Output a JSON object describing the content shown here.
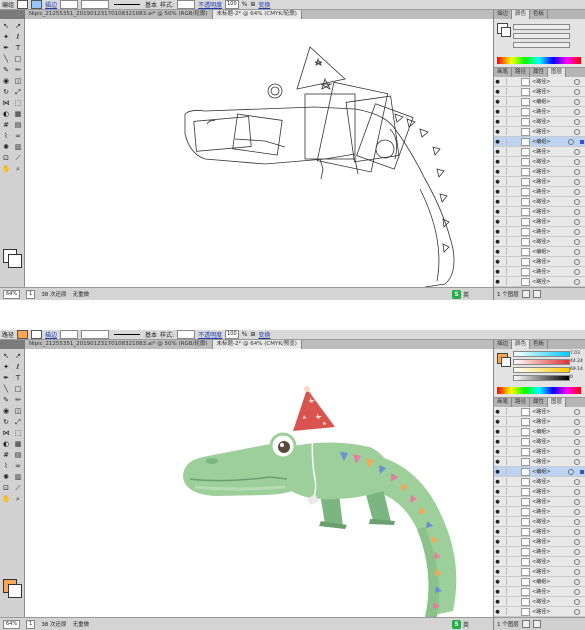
{
  "shot1": {
    "control_bar": {
      "tool_label": "编组",
      "stroke_link": "描边",
      "stroke_weight": "基本",
      "style_label": "样式:",
      "opacity_link": "不透明度",
      "opacity_value": "100",
      "opacity_unit": "%",
      "transform_link": "变换",
      "fill_color": "#ffffff",
      "stroke_color": "#9ac5ff"
    },
    "doc_tabs": [
      {
        "label": "Nipic_21255351_20190123170108321083.ai* @ 50% (RGB/轮廓)"
      },
      {
        "label": "未标题-2* @ 64% (CMYK/轮廓)"
      }
    ],
    "status": {
      "zoom": "64%",
      "page": "1",
      "undo": "38 次还原",
      "undo2": "无重做"
    },
    "panel_tabs": [
      "描边",
      "颜色",
      "色板"
    ],
    "layer_tabs": [
      "画笔",
      "路径",
      "属性",
      "图层"
    ],
    "layers": [
      "<路径>",
      "<路径>",
      "<编组>",
      "<路径>",
      "<路径>",
      "<路径>",
      "<编组>",
      "<路径>",
      "<路径>",
      "<路径>",
      "<路径>",
      "<路径>",
      "<路径>",
      "<路径>",
      "<路径>",
      "<路径>",
      "<路径>",
      "<编组>",
      "<路径>",
      "<路径>",
      "<路径>",
      "<路径>",
      "<路径>"
    ],
    "layer_count": "1 个图层",
    "ime": "英"
  },
  "shot2": {
    "control_bar": {
      "tool_label": "路径",
      "stroke_link": "描边",
      "stroke_weight": "基本",
      "style_label": "样式:",
      "opacity_link": "不透明度",
      "opacity_value": "100",
      "opacity_unit": "%",
      "transform_link": "变换",
      "fill_color": "#f5a755",
      "stroke_color": "#ffffff"
    },
    "doc_tabs": [
      {
        "label": "Nipic_21255351_20190123170108321083.ai* @ 50% (RGB/轮廓)"
      },
      {
        "label": "未标题-2* @ 64% (CMYK/预览)"
      }
    ],
    "status": {
      "zoom": "64%",
      "page": "1",
      "undo": "38 次还原",
      "undo2": "无重做"
    },
    "panel_tabs": [
      "描边",
      "颜色",
      "色板"
    ],
    "color_values": [
      "7.03",
      "44.24",
      "69.14",
      "0"
    ],
    "layer_tabs": [
      "画笔",
      "路径",
      "属性",
      "图层"
    ],
    "layers": [
      "<路径>",
      "<路径>",
      "<编组>",
      "<路径>",
      "<路径>",
      "<路径>",
      "<编组>",
      "<路径>",
      "<路径>",
      "<路径>",
      "<路径>",
      "<路径>",
      "<路径>",
      "<路径>",
      "<路径>",
      "<路径>",
      "<路径>",
      "<编组>",
      "<路径>",
      "<路径>",
      "<路径>",
      "<路径>",
      "<路径>"
    ],
    "layer_count": "1 个图层",
    "ime": "英"
  },
  "colors": {
    "croc_green": "#9ccf9a",
    "croc_dark": "#7bb57f",
    "hat_red": "#d9534f",
    "flag_orange": "#f5a755",
    "flag_blue": "#6a8fd6",
    "flag_pink": "#e87ba3"
  }
}
